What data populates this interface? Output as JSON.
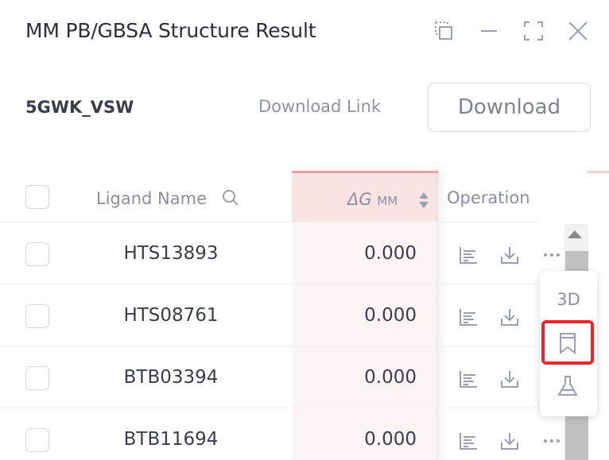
{
  "window": {
    "title": "MM PB/GBSA Structure Result",
    "controls": [
      "restore-icon",
      "minimize-icon",
      "maximize-icon",
      "close-icon"
    ]
  },
  "info": {
    "structure_name": "5GWK_VSW",
    "download_link_label": "Download Link",
    "download_button": "Download"
  },
  "table": {
    "headers": {
      "ligand_name": "Ligand Name",
      "delta_g": "ΔG",
      "delta_g_sub": "MM",
      "operation": "Operation"
    },
    "rows": [
      {
        "name": "HTS13893",
        "value": "0.000"
      },
      {
        "name": "HTS08761",
        "value": "0.000"
      },
      {
        "name": "BTB03394",
        "value": "0.000"
      },
      {
        "name": "BTB11694",
        "value": "0.000"
      }
    ],
    "row_icons": [
      "bar-chart-icon",
      "download-icon",
      "more-icon"
    ]
  },
  "popup_menu": {
    "items": [
      {
        "label": "3D"
      },
      {
        "icon": "bookmark-icon",
        "highlighted": true
      },
      {
        "icon": "flask-icon"
      }
    ]
  },
  "colors": {
    "sorted_column_bg": "#fdf5f5",
    "sorted_header_bg": "#f9e3e3",
    "highlight_border": "#e8262b"
  }
}
